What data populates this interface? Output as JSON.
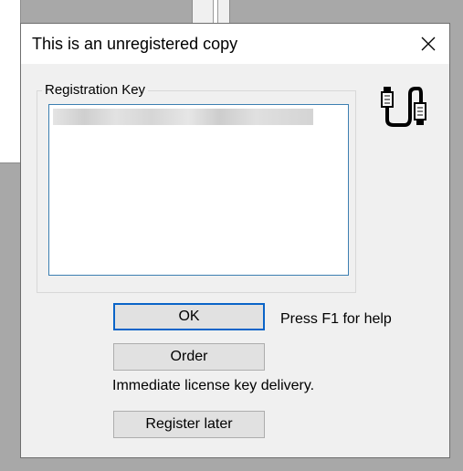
{
  "dialog": {
    "title": "This is an unregistered copy",
    "group_label": "Registration Key",
    "key_value": "",
    "ok_label": "OK",
    "order_label": "Order",
    "register_later_label": "Register later",
    "help_text": "Press F1 for help",
    "delivery_text": "Immediate license key delivery.",
    "icons": {
      "close": "close-icon",
      "connector": "cable-connector-icon"
    }
  },
  "colors": {
    "title_bar": "#ffffff",
    "dialog_bg": "#f0f0f0",
    "default_button_border": "#0a64c8",
    "keybox_border": "#3c7fb1"
  }
}
